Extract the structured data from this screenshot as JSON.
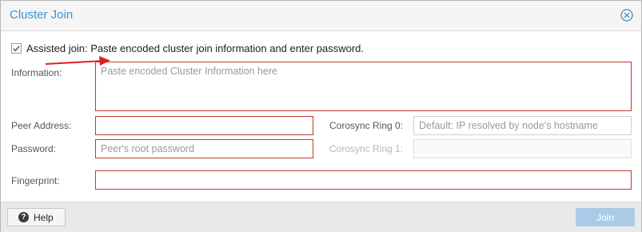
{
  "window": {
    "title": "Cluster Join"
  },
  "assisted": {
    "label": "Assisted join: Paste encoded cluster join information and enter password.",
    "checked": true
  },
  "information": {
    "label": "Information:",
    "placeholder": "Paste encoded Cluster Information here",
    "value": ""
  },
  "peer_address": {
    "label": "Peer Address:",
    "value": ""
  },
  "password": {
    "label": "Password:",
    "placeholder": "Peer's root password",
    "value": ""
  },
  "ring0": {
    "label": "Corosync Ring 0:",
    "placeholder": "Default: IP resolved by node's hostname",
    "value": ""
  },
  "ring1": {
    "label": "Corosync Ring 1:",
    "value": "",
    "disabled": true
  },
  "fingerprint": {
    "label": "Fingerprint:",
    "value": ""
  },
  "footer": {
    "help_label": "Help",
    "join_label": "Join"
  },
  "colors": {
    "accent": "#3892d4",
    "error_border": "#c0392b",
    "annotation_arrow": "#e02020",
    "join_disabled": "#a9cbe7"
  },
  "icons": {
    "close": "close-circle-icon",
    "help": "question-circle-icon",
    "checkbox": "checkbox-checked-icon",
    "annotation": "red-arrow-icon"
  }
}
